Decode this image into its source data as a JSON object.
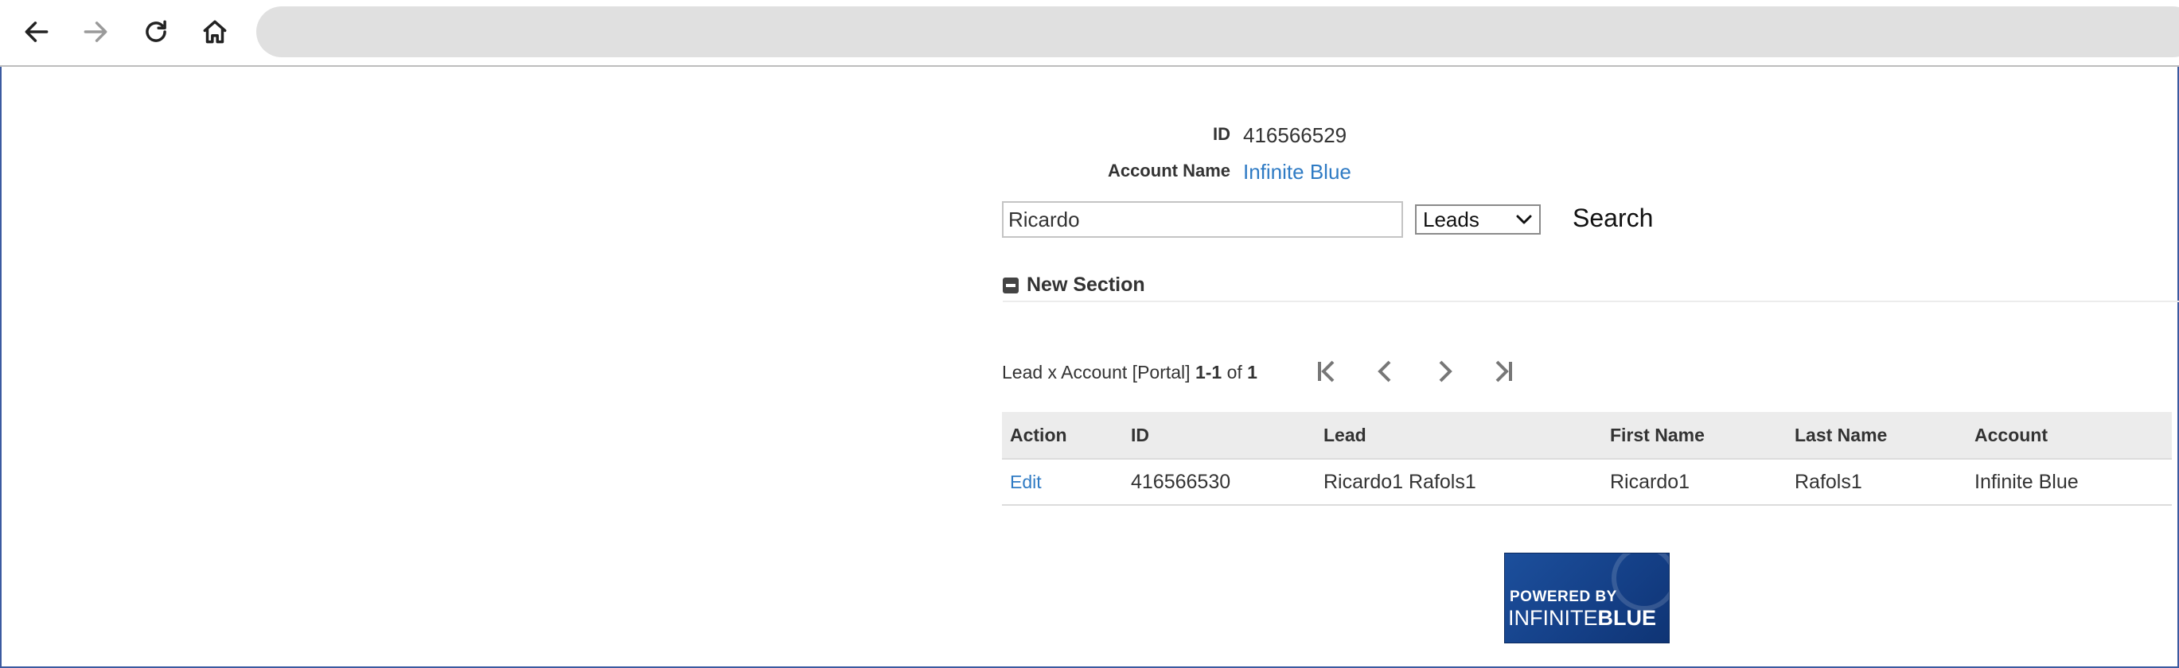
{
  "browser": {
    "icons": [
      "back-arrow-icon",
      "forward-arrow-icon",
      "reload-icon",
      "home-icon"
    ],
    "address": ""
  },
  "record": {
    "id_label": "ID",
    "id_value": "416566529",
    "account_label": "Account Name",
    "account_value": "Infinite Blue"
  },
  "search": {
    "query": "Ricardo",
    "scope": "Leads",
    "button": "Search"
  },
  "section": {
    "title": "New Section"
  },
  "pager": {
    "prefix": "Lead x Account [Portal]",
    "range": "1-1",
    "of": "of",
    "total": "1"
  },
  "table": {
    "columns": [
      "Action",
      "ID",
      "Lead",
      "First Name",
      "Last Name",
      "Account"
    ],
    "rows": [
      {
        "action": "Edit",
        "id": "416566530",
        "lead": "Ricardo1 Rafols1",
        "first_name": "Ricardo1",
        "last_name": "Rafols1",
        "account": "Infinite Blue"
      }
    ]
  },
  "footer": {
    "logo_line1": "POWERED BY",
    "logo_line2a": "INFINITE",
    "logo_line2b": "BLUE"
  },
  "colors": {
    "link": "#2f7bc4",
    "logo_bg": "#1c4f9c",
    "frame_border": "#3b5aa0"
  }
}
